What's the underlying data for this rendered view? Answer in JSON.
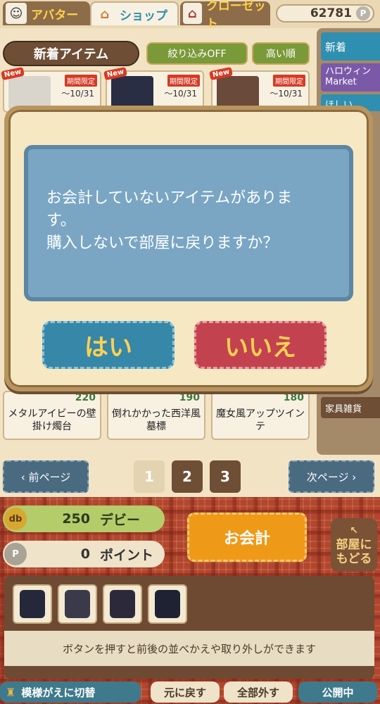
{
  "topbar": {
    "tabs": [
      {
        "label": "アバター",
        "icon": "avatar-icon"
      },
      {
        "label": "ショップ",
        "icon": "shop-icon"
      },
      {
        "label": "クローゼット",
        "icon": "closet-icon"
      }
    ],
    "points": "62781",
    "points_symbol": "P"
  },
  "shop": {
    "title": "新着アイテム",
    "filter_label": "絞り込みOFF",
    "sort_label": "高い順"
  },
  "categories": {
    "new": "新着",
    "halloween": "ハロウィン Market",
    "wish": "ほしい",
    "furniture": "家具雑貨"
  },
  "cards_top": [
    {
      "badge": "New",
      "limit": "期間限定",
      "date": "〜10/31"
    },
    {
      "badge": "New",
      "limit": "期間限定",
      "date": "〜10/31"
    },
    {
      "badge": "New",
      "limit": "期間限定",
      "date": "〜10/31"
    }
  ],
  "cards_bottom": [
    {
      "price": "220",
      "name": "メタルアイビーの壁掛け燭台"
    },
    {
      "price": "190",
      "name": "倒れかかった西洋風墓標"
    },
    {
      "price": "180",
      "name": "魔女風アップツインテ"
    }
  ],
  "pager": {
    "prev": "‹ 前ページ",
    "next": "次ページ ›",
    "pages": [
      "1",
      "2",
      "3"
    ],
    "current": 1
  },
  "wallet": {
    "debi_symbol": "db",
    "debi_value": "250",
    "debi_unit": "デビー",
    "point_symbol": "P",
    "point_value": "0",
    "point_unit": "ポイント"
  },
  "checkout_label": "お会計",
  "back_room_label": "部屋にもどる",
  "equip_hint": "ボタンを押すと前後の並べかえや取り外しができます",
  "bottom_buttons": {
    "pattern": "模様がえに切替",
    "undo": "元に戻す",
    "remove_all": "全部外す",
    "public": "公開中"
  },
  "dialog": {
    "line1": "お会計していないアイテムがありま",
    "line2": "す。",
    "line3": "購入しないで部屋に戻りますか？",
    "yes": "はい",
    "no": "いいえ"
  },
  "colors": {
    "accent_blue": "#3787a8",
    "accent_red": "#c2434f",
    "checkout_orange": "#ee9a18"
  }
}
